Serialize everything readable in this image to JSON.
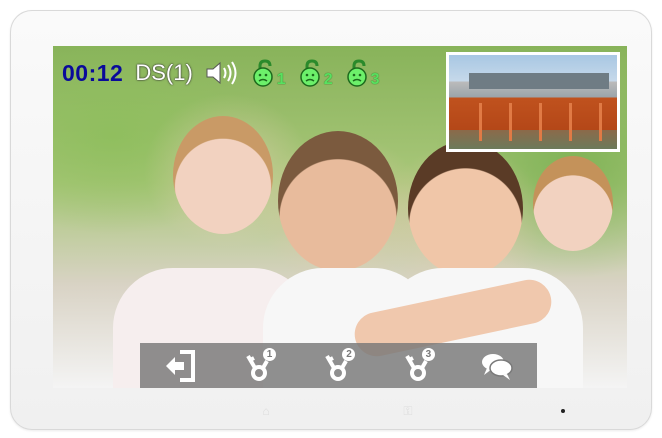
{
  "status_bar": {
    "timer": "00:12",
    "door_station": "DS(1)",
    "speaker_icon": "speaker-volume-icon",
    "locks": [
      {
        "icon": "unlock-1-icon",
        "number": "1"
      },
      {
        "icon": "unlock-2-icon",
        "number": "2"
      },
      {
        "icon": "unlock-3-icon",
        "number": "3"
      }
    ],
    "colors": {
      "timer": "#0a0a9a",
      "lock": "#6cf06a"
    }
  },
  "pip_preview": {
    "description": "camera-view"
  },
  "toolbar": {
    "buttons": [
      {
        "icon": "exit-back-icon",
        "badge": ""
      },
      {
        "icon": "key-unlock-1-icon",
        "badge": "1"
      },
      {
        "icon": "key-unlock-2-icon",
        "badge": "2"
      },
      {
        "icon": "key-unlock-3-icon",
        "badge": "3"
      },
      {
        "icon": "talk-chat-icon",
        "badge": ""
      }
    ]
  }
}
